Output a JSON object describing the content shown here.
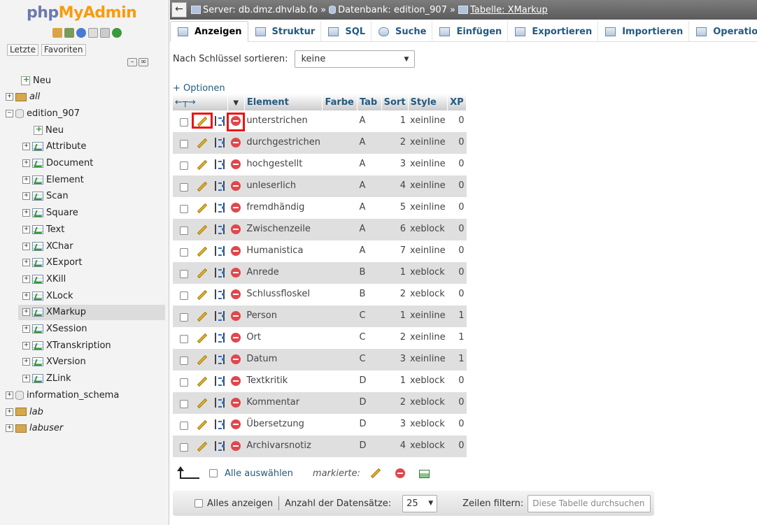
{
  "nav": {
    "logo_php": "php",
    "logo_rest": "MyAdmin",
    "recent_label": "Letzte",
    "favorites_label": "Favoriten",
    "tree": [
      {
        "label": "Neu",
        "type": "new",
        "level": 1
      },
      {
        "label": "all",
        "type": "group",
        "level": 0,
        "italic": true
      },
      {
        "label": "edition_907",
        "type": "db",
        "level": 0,
        "expanded": true
      },
      {
        "label": "Neu",
        "type": "new",
        "level": 2
      },
      {
        "label": "Attribute",
        "type": "table",
        "level": 2
      },
      {
        "label": "Document",
        "type": "table",
        "level": 2
      },
      {
        "label": "Element",
        "type": "table",
        "level": 2
      },
      {
        "label": "Scan",
        "type": "table",
        "level": 2
      },
      {
        "label": "Square",
        "type": "table",
        "level": 2
      },
      {
        "label": "Text",
        "type": "table",
        "level": 2
      },
      {
        "label": "XChar",
        "type": "table",
        "level": 2
      },
      {
        "label": "XExport",
        "type": "table",
        "level": 2
      },
      {
        "label": "XKill",
        "type": "table",
        "level": 2
      },
      {
        "label": "XLock",
        "type": "table",
        "level": 2
      },
      {
        "label": "XMarkup",
        "type": "table",
        "level": 2,
        "selected": true
      },
      {
        "label": "XSession",
        "type": "table",
        "level": 2
      },
      {
        "label": "XTranskription",
        "type": "table",
        "level": 2
      },
      {
        "label": "XVersion",
        "type": "table",
        "level": 2
      },
      {
        "label": "ZLink",
        "type": "table",
        "level": 2
      },
      {
        "label": "information_schema",
        "type": "db",
        "level": 0
      },
      {
        "label": "lab",
        "type": "group",
        "level": 0,
        "italic": true
      },
      {
        "label": "labuser",
        "type": "group",
        "level": 0,
        "italic": true
      }
    ]
  },
  "breadcrumb": {
    "server": "Server: db.dmz.dhvlab.fo",
    "database": "Datenbank: edition_907",
    "table": "Tabelle: XMarkup",
    "separator": "»"
  },
  "tabs": [
    "Anzeigen",
    "Struktur",
    "SQL",
    "Suche",
    "Einfügen",
    "Exportieren",
    "Importieren",
    "Operationen"
  ],
  "sort": {
    "label": "Nach Schlüssel sortieren:",
    "value": "keine"
  },
  "options_link": "+ Optionen",
  "table": {
    "columns": [
      "Element",
      "Farbe",
      "Tab",
      "Sort",
      "Style",
      "XP"
    ],
    "rows": [
      [
        "unterstrichen",
        "",
        "A",
        "1",
        "xeinline",
        "0"
      ],
      [
        "durchgestrichen",
        "",
        "A",
        "2",
        "xeinline",
        "0"
      ],
      [
        "hochgestellt",
        "",
        "A",
        "3",
        "xeinline",
        "0"
      ],
      [
        "unleserlich",
        "",
        "A",
        "4",
        "xeinline",
        "0"
      ],
      [
        "fremdhändig",
        "",
        "A",
        "5",
        "xeinline",
        "0"
      ],
      [
        "Zwischenzeile",
        "",
        "A",
        "6",
        "xeblock",
        "0"
      ],
      [
        "Humanistica",
        "",
        "A",
        "7",
        "xeinline",
        "0"
      ],
      [
        "Anrede",
        "",
        "B",
        "1",
        "xeblock",
        "0"
      ],
      [
        "Schlussfloskel",
        "",
        "B",
        "2",
        "xeblock",
        "0"
      ],
      [
        "Person",
        "",
        "C",
        "1",
        "xeinline",
        "1"
      ],
      [
        "Ort",
        "",
        "C",
        "2",
        "xeinline",
        "1"
      ],
      [
        "Datum",
        "",
        "C",
        "3",
        "xeinline",
        "1"
      ],
      [
        "Textkritik",
        "",
        "D",
        "1",
        "xeblock",
        "0"
      ],
      [
        "Kommentar",
        "",
        "D",
        "2",
        "xeblock",
        "0"
      ],
      [
        "Übersetzung",
        "",
        "D",
        "3",
        "xeblock",
        "0"
      ],
      [
        "Archivarsnotiz",
        "",
        "D",
        "4",
        "xeblock",
        "0"
      ]
    ]
  },
  "footer": {
    "select_all": "Alle auswählen",
    "marked": "markierte:",
    "show_all": "Alles anzeigen",
    "row_count_label": "Anzahl der Datensätze:",
    "row_count_value": "25",
    "filter_label": "Zeilen filtern:",
    "filter_placeholder": "Diese Tabelle durchsuchen"
  },
  "colors": {
    "link": "#235a81",
    "highlight": "#e11111",
    "row_alt": "#dfdfdf"
  }
}
